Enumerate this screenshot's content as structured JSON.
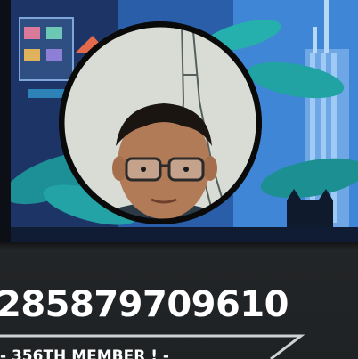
{
  "profile": {
    "user_id": "285879709610",
    "member_text": "- 356TH MEMBER ! -"
  },
  "icons": {
    "avatar": "user-photo",
    "banner": "city-skyline-illustration"
  },
  "colors": {
    "background": "#232628",
    "text": "#ffffff",
    "avatar_ring": "#0a0a0a",
    "banner_blue": "#204f97",
    "divider": "#cfd2d4"
  }
}
